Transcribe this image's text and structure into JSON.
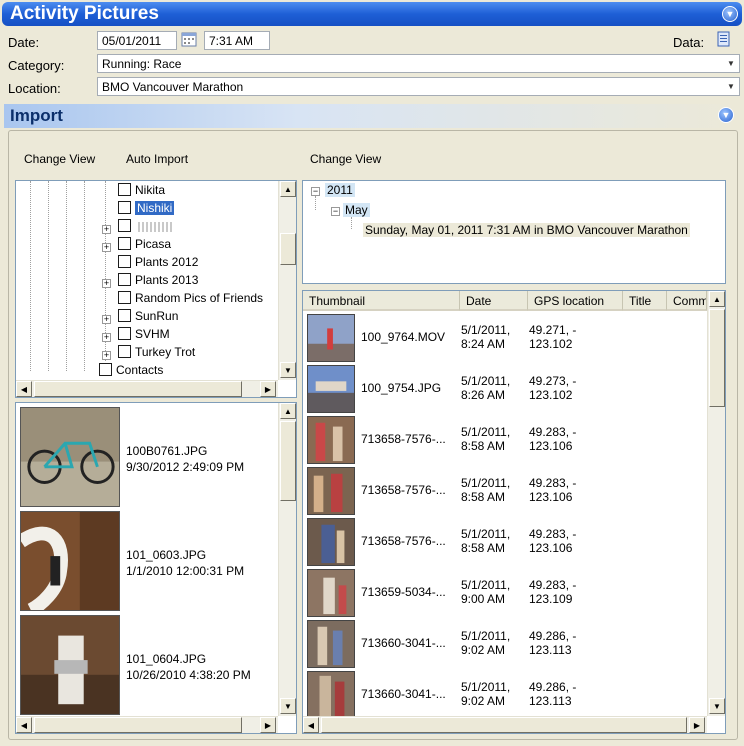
{
  "header": {
    "title": "Activity Pictures"
  },
  "form": {
    "date_label": "Date:",
    "date_value": "05/01/2011",
    "time_value": "7:31 AM",
    "data_label": "Data:",
    "category_label": "Category:",
    "category_value": "Running: Race",
    "location_label": "Location:",
    "location_value": "BMO Vancouver Marathon"
  },
  "import": {
    "title": "Import",
    "left_change_view": "Change View",
    "auto_import": "Auto Import",
    "right_change_view": "Change View"
  },
  "folder_tree": {
    "items": [
      {
        "label": "Nikita",
        "expandable": false,
        "selected": false
      },
      {
        "label": "Nishiki",
        "expandable": false,
        "selected": true
      },
      {
        "label": "",
        "expandable": true,
        "selected": false
      },
      {
        "label": "Picasa",
        "expandable": true,
        "selected": false
      },
      {
        "label": "Plants 2012",
        "expandable": false,
        "selected": false
      },
      {
        "label": "Plants 2013",
        "expandable": true,
        "selected": false
      },
      {
        "label": "Random Pics of Friends",
        "expandable": false,
        "selected": false
      },
      {
        "label": "SunRun",
        "expandable": true,
        "selected": false
      },
      {
        "label": "SVHM",
        "expandable": true,
        "selected": false
      },
      {
        "label": "Turkey Trot",
        "expandable": true,
        "selected": false
      }
    ],
    "contacts_label": "Contacts"
  },
  "photos": [
    {
      "name": "100B0761.JPG",
      "date": "9/30/2012 2:49:09 PM"
    },
    {
      "name": "101_0603.JPG",
      "date": "1/1/2010 12:00:31 PM"
    },
    {
      "name": "101_0604.JPG",
      "date": "10/26/2010 4:38:20 PM"
    }
  ],
  "date_tree": {
    "year": "2011",
    "month": "May",
    "entry": "Sunday, May 01, 2011 7:31 AM in BMO Vancouver Marathon"
  },
  "table": {
    "columns": [
      "Thumbnail",
      "Date",
      "GPS location",
      "Title",
      "Comm"
    ],
    "rows": [
      {
        "name": "100_9764.MOV",
        "date1": "5/1/2011,",
        "date2": "8:24 AM",
        "gps1": "49.271, -",
        "gps2": "123.102"
      },
      {
        "name": "100_9754.JPG",
        "date1": "5/1/2011,",
        "date2": "8:26 AM",
        "gps1": "49.273, -",
        "gps2": "123.102"
      },
      {
        "name": "713658-7576-...",
        "date1": "5/1/2011,",
        "date2": "8:58 AM",
        "gps1": "49.283, -",
        "gps2": "123.106"
      },
      {
        "name": "713658-7576-...",
        "date1": "5/1/2011,",
        "date2": "8:58 AM",
        "gps1": "49.283, -",
        "gps2": "123.106"
      },
      {
        "name": "713658-7576-...",
        "date1": "5/1/2011,",
        "date2": "8:58 AM",
        "gps1": "49.283, -",
        "gps2": "123.106"
      },
      {
        "name": "713659-5034-...",
        "date1": "5/1/2011,",
        "date2": "9:00 AM",
        "gps1": "49.283, -",
        "gps2": "123.109"
      },
      {
        "name": "713660-3041-...",
        "date1": "5/1/2011,",
        "date2": "9:02 AM",
        "gps1": "49.286, -",
        "gps2": "123.113"
      },
      {
        "name": "713660-3041-...",
        "date1": "5/1/2011,",
        "date2": "9:02 AM",
        "gps1": "49.286, -",
        "gps2": "123.113"
      }
    ]
  },
  "icons": {
    "collapse": "chevron-down-icon",
    "calendar": "calendar-icon",
    "data": "data-icon"
  },
  "colors": {
    "titlebar": "#1e5fd6",
    "selection": "#316ac5",
    "date_highlight": "#d3e6f5"
  }
}
